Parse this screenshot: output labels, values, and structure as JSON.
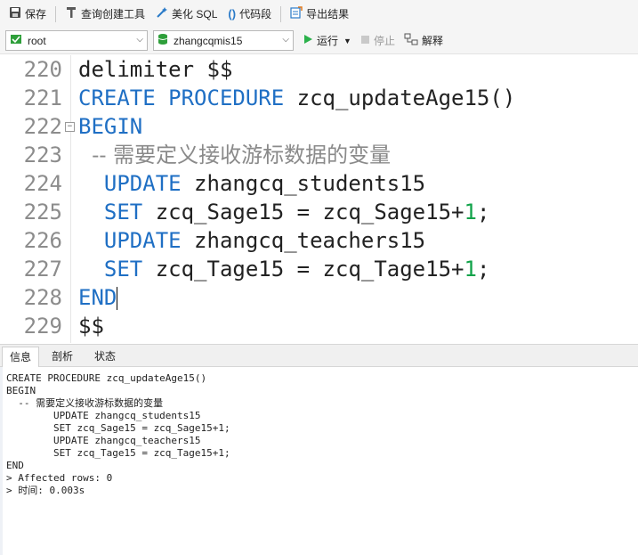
{
  "toolbar": {
    "save_label": "保存",
    "query_builder_label": "查询创建工具",
    "beautify_label": "美化 SQL",
    "snippet_label": "代码段",
    "export_label": "导出结果"
  },
  "connection_bar": {
    "user_value": "root",
    "database_value": "zhangcqmis15",
    "run_label": "运行",
    "stop_label": "停止",
    "explain_label": "解释"
  },
  "editor": {
    "line_numbers": [
      "220",
      "221",
      "222",
      "223",
      "224",
      "225",
      "226",
      "227",
      "228",
      "229"
    ],
    "lines": [
      {
        "parts": [
          {
            "text": "delimiter $$",
            "cls": ""
          }
        ]
      },
      {
        "parts": [
          {
            "text": "CREATE PROCEDURE",
            "cls": "kw"
          },
          {
            "text": " zcq_updateAge15()",
            "cls": ""
          }
        ]
      },
      {
        "parts": [
          {
            "text": "BEGIN",
            "cls": "kw"
          }
        ]
      },
      {
        "parts": [
          {
            "text": "  -- 需要定义接收游标数据的变量",
            "cls": "cmt"
          }
        ]
      },
      {
        "parts": [
          {
            "text": "  UPDATE",
            "cls": "kw"
          },
          {
            "text": " zhangcq_students15",
            "cls": ""
          }
        ]
      },
      {
        "parts": [
          {
            "text": "  SET",
            "cls": "kw"
          },
          {
            "text": " zcq_Sage15 = zcq_Sage15+",
            "cls": ""
          },
          {
            "text": "1",
            "cls": "num"
          },
          {
            "text": ";",
            "cls": ""
          }
        ]
      },
      {
        "parts": [
          {
            "text": "  UPDATE",
            "cls": "kw"
          },
          {
            "text": " zhangcq_teachers15",
            "cls": ""
          }
        ]
      },
      {
        "parts": [
          {
            "text": "  SET",
            "cls": "kw"
          },
          {
            "text": " zcq_Tage15 = zcq_Tage15+",
            "cls": ""
          },
          {
            "text": "1",
            "cls": "num"
          },
          {
            "text": ";",
            "cls": ""
          }
        ]
      },
      {
        "parts": [
          {
            "text": "END",
            "cls": "kw"
          }
        ]
      },
      {
        "parts": [
          {
            "text": "$$",
            "cls": ""
          }
        ]
      }
    ]
  },
  "results_tabs": [
    "信息",
    "剖析",
    "状态"
  ],
  "output_lines": [
    "CREATE PROCEDURE zcq_updateAge15()",
    "BEGIN",
    "  -- 需要定义接收游标数据的变量",
    "        UPDATE zhangcq_students15",
    "        SET zcq_Sage15 = zcq_Sage15+1;",
    "        UPDATE zhangcq_teachers15",
    "        SET zcq_Tage15 = zcq_Tage15+1;",
    "END",
    "> Affected rows: 0",
    "> 时间: 0.003s"
  ],
  "colors": {
    "keyword": "#1f6fc4",
    "number": "#11a34a",
    "comment": "#8a8a8a",
    "run_icon": "#2bb14b",
    "db_icon": "#2e9f3a"
  },
  "icons": {
    "save": "save-icon",
    "query_builder": "query-builder-icon",
    "beautify": "magic-wand-icon",
    "snippet": "code-snippet-icon",
    "export": "export-icon",
    "user": "user-icon",
    "database": "database-icon",
    "run": "play-icon",
    "stop": "stop-icon",
    "explain": "explain-icon"
  }
}
